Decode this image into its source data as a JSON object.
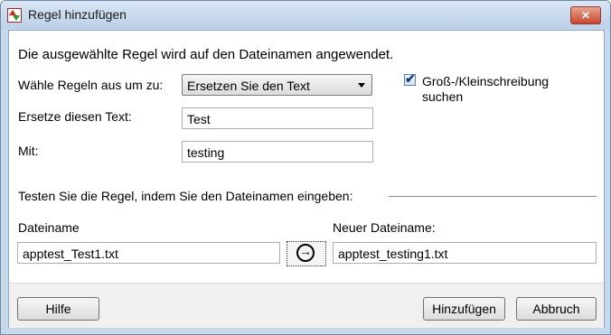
{
  "window": {
    "title": "Regel hinzufügen",
    "close_label": "✕"
  },
  "main": {
    "description": "Die ausgewählte Regel wird auf den Dateinamen angewendet.",
    "rule_label": "Wähle Regeln aus um zu:",
    "rule_select_value": "Ersetzen Sie den Text",
    "replace_label": "Ersetze diesen Text:",
    "replace_value": "Test",
    "with_label": "Mit:",
    "with_value": "testing",
    "case_checkbox": {
      "checked": true,
      "label": "Groß-/Kleinschreibung suchen"
    }
  },
  "test": {
    "section_label": "Testen Sie die Regel, indem Sie den Dateinamen eingeben:",
    "filename_label": "Dateiname",
    "filename_value": "apptest_Test1.txt",
    "new_filename_label": "Neuer Dateiname:",
    "new_filename_value": "apptest_testing1.txt"
  },
  "buttons": {
    "help": "Hilfe",
    "add": "Hinzufügen",
    "cancel": "Abbruch"
  },
  "icons": {
    "app": "rename-app-icon",
    "arrow": "arrow-right-circle-icon",
    "close": "close-icon"
  }
}
